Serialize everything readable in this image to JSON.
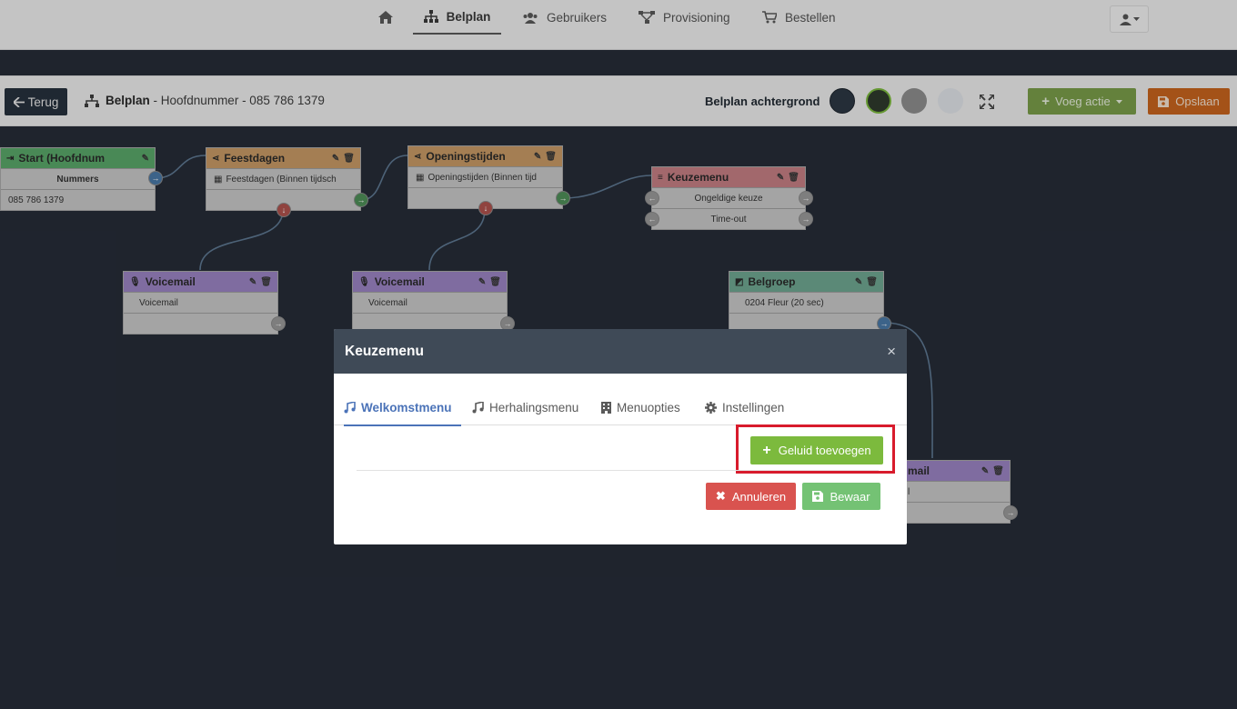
{
  "nav": {
    "home_icon": "home-icon",
    "items": [
      {
        "label": "Belplan",
        "icon": "sitemap-icon",
        "active": true
      },
      {
        "label": "Gebruikers",
        "icon": "users-icon",
        "active": false
      },
      {
        "label": "Provisioning",
        "icon": "network-icon",
        "active": false
      },
      {
        "label": "Bestellen",
        "icon": "cart-icon",
        "active": false
      }
    ],
    "user_icon": "user-icon"
  },
  "toolbar": {
    "back_label": "Terug",
    "plan_title": "Belplan",
    "plan_subtitle": "- Hoofdnummer - 085 786 1379",
    "background_label": "Belplan achtergrond",
    "swatches": [
      "#2c3744",
      "#2f3a2c",
      "#8e8e8e",
      "#d9dde6"
    ],
    "add_action_label": "Voeg actie",
    "save_label": "Opslaan"
  },
  "nodes": {
    "start": {
      "title": "Start (Hoofdnum",
      "rows": [
        "Nummers",
        "085 786 1379"
      ],
      "color": "#5aa86a"
    },
    "feestdagen": {
      "title": "Feestdagen",
      "rows": [
        "Feestdagen (Binnen tijdsch",
        ""
      ],
      "color": "#c89a66"
    },
    "openingstijden": {
      "title": "Openingstijden",
      "rows": [
        "Openingstijden (Binnen tijd",
        ""
      ],
      "color": "#c89a66"
    },
    "keuzemenu": {
      "title": "Keuzemenu",
      "rows": [
        "Ongeldige keuze",
        "Time-out"
      ],
      "color": "#c67f84"
    },
    "voicemail1": {
      "title": "Voicemail",
      "rows": [
        "Voicemail",
        ""
      ],
      "color": "#9b84c4"
    },
    "voicemail2": {
      "title": "Voicemail",
      "rows": [
        "Voicemail",
        ""
      ],
      "color": "#9b84c4"
    },
    "belgroep": {
      "title": "Belgroep",
      "rows": [
        "0204 Fleur (20 sec)",
        ""
      ],
      "color": "#6fa892"
    },
    "partial": {
      "title": "mail",
      "rows": [
        "l",
        ""
      ],
      "color": "#9b84c4"
    }
  },
  "modal": {
    "title": "Keuzemenu",
    "close": "×",
    "tabs": [
      {
        "label": "Welkomstmenu",
        "icon": "music-icon",
        "active": true
      },
      {
        "label": "Herhalingsmenu",
        "icon": "music-icon",
        "active": false
      },
      {
        "label": "Menuopties",
        "icon": "building-icon",
        "active": false
      },
      {
        "label": "Instellingen",
        "icon": "gear-icon",
        "active": false
      }
    ],
    "add_sound_label": "Geluid toevoegen",
    "cancel_label": "Annuleren",
    "save_label": "Bewaar",
    "colors": {
      "accent": "#4b73b8",
      "add": "#7cba3d",
      "cancel": "#d9534f",
      "save": "#5cb85c",
      "highlight": "#d81b2c"
    }
  }
}
